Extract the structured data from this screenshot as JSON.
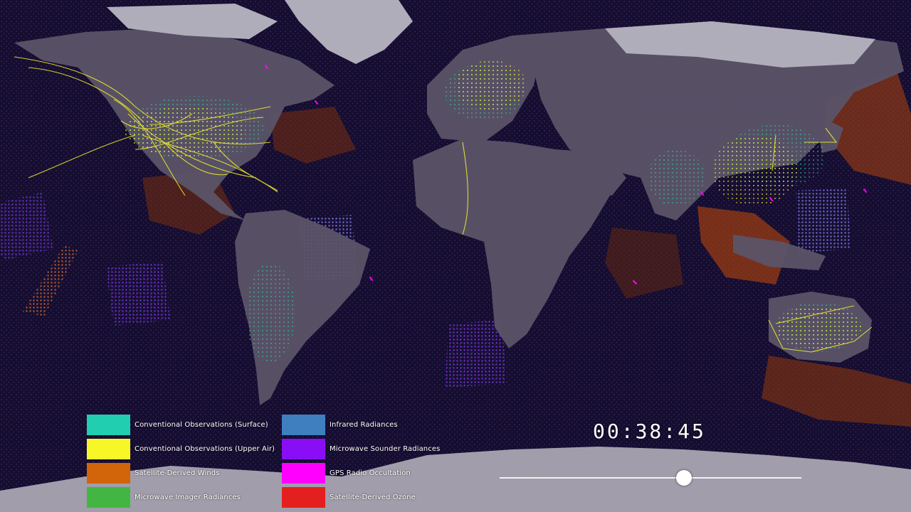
{
  "legend": {
    "left": [
      {
        "label": "Conventional Observations (Surface)",
        "color": "#22ceb0"
      },
      {
        "label": "Conventional Observations (Upper Air)",
        "color": "#f7f728"
      },
      {
        "label": "Satellite-Derived Winds",
        "color": "#d26409"
      },
      {
        "label": "Microwave Imager Radiances",
        "color": "#43b543"
      }
    ],
    "right": [
      {
        "label": "Infrared Radiances",
        "color": "#3f7fbf"
      },
      {
        "label": "Microwave Sounder Radiances",
        "color": "#8a0ef5"
      },
      {
        "label": "GPS Radio Occultation",
        "color": "#ff00ff"
      },
      {
        "label": "Satellite-Derived Ozone",
        "color": "#e41f1f"
      }
    ]
  },
  "playback": {
    "time": "00:38:45",
    "progress": 0.61
  }
}
